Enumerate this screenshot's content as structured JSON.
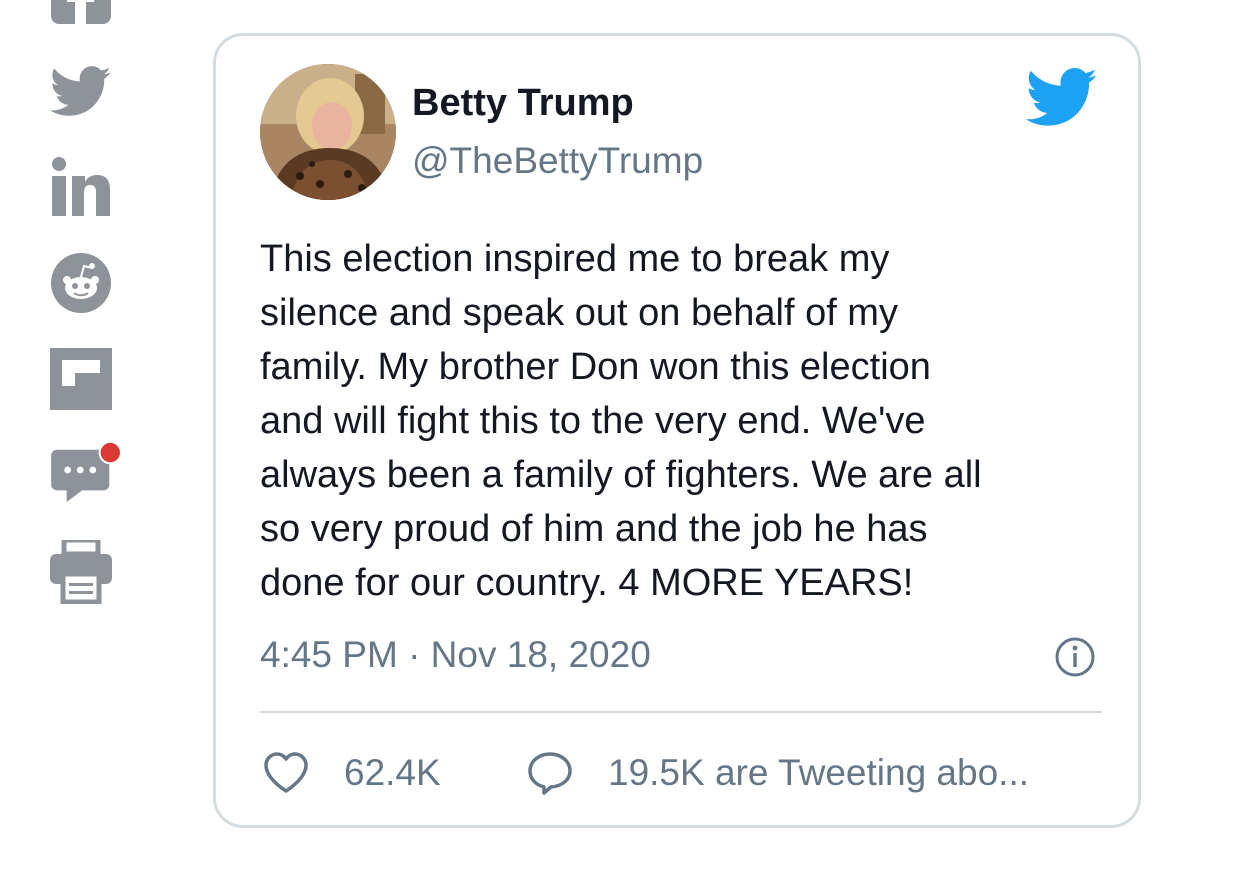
{
  "share_rail": {
    "icons": [
      "facebook-icon",
      "twitter-icon",
      "linkedin-icon",
      "reddit-icon",
      "flipboard-icon",
      "comments-icon",
      "print-icon"
    ],
    "icon_color": "#8e9399",
    "notification_color": "#d93a34"
  },
  "tweet": {
    "author_name": "Betty Trump",
    "author_handle": "@TheBettyTrump",
    "lines": [
      "This election inspired me to break my",
      "silence and speak out on behalf of my",
      "family. My brother Don won this election",
      "and will fight this to the very end. We've",
      "always been a family of fighters. We are all",
      "so very proud of him and the job he has",
      "done for our country. 4 MORE YEARS!"
    ],
    "timestamp": "4:45 PM · Nov 18, 2020",
    "likes": "62.4K",
    "replies": "19.5K are Tweeting abo...",
    "brand_color": "#1da1f2",
    "secondary_text_color": "#657786"
  }
}
